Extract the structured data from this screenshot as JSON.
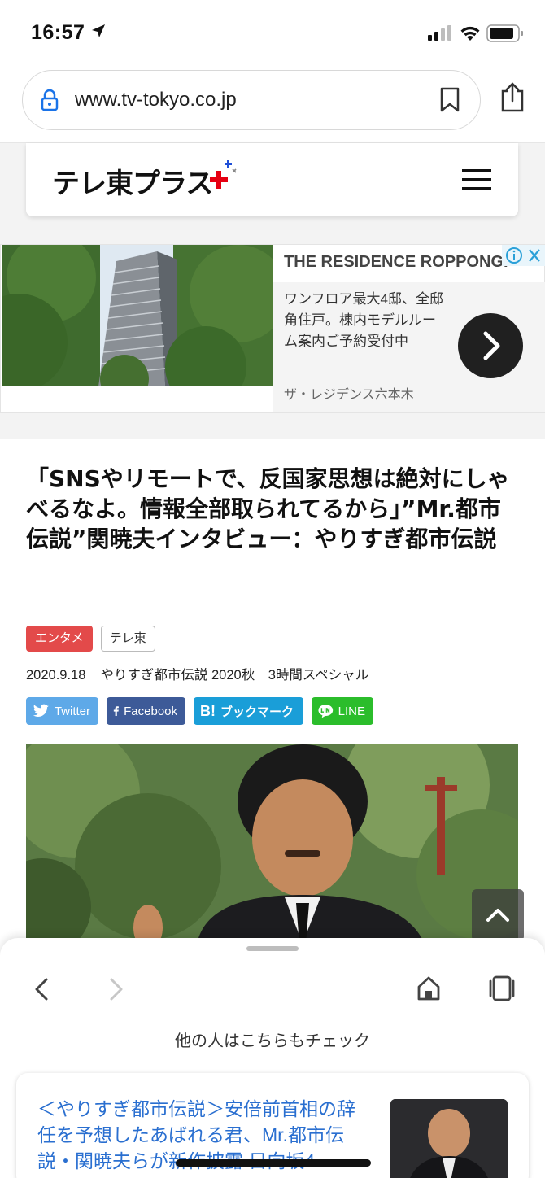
{
  "status_bar": {
    "time": "16:57"
  },
  "browser": {
    "url": "www.tv-tokyo.co.jp"
  },
  "site": {
    "logo_text": "テレ東プラス"
  },
  "ad": {
    "title": "THE RESIDENCE ROPPONGI",
    "description": "ワンフロア最大4邸、全邸角住戸。棟内モデルルーム案内ご予約受付中",
    "brand": "ザ・レジデンス六本木"
  },
  "article": {
    "title": "「SNSやリモートで、反国家思想は絶対にしゃべるなよ。情報全部取られてるから」”Mr.都市伝説”関暁夫インタビュー：やりすぎ都市伝説",
    "tags": [
      "エンタメ",
      "テレ東"
    ],
    "date": "2020.9.18",
    "program": "やりすぎ都市伝説 2020秋　3時間スペシャル",
    "share": {
      "twitter": "Twitter",
      "facebook": "Facebook",
      "hatena": "ブックマーク",
      "hatena_mark": "B!",
      "line": "LINE"
    }
  },
  "sheet": {
    "label": "他の人はこちらもチェック",
    "recommendation": "＜やりすぎ都市伝説＞安倍前首相の辞任を予想したあばれる君、Mr.都市伝説・関暁夫らが新作披露 日向坂4..."
  },
  "colors": {
    "tag_red": "#e34a4a",
    "twitter": "#5ea9e8",
    "facebook": "#3d5a98",
    "hatena": "#1a9ed8",
    "line": "#2bbd2b",
    "link_blue": "#2a6fd0"
  }
}
